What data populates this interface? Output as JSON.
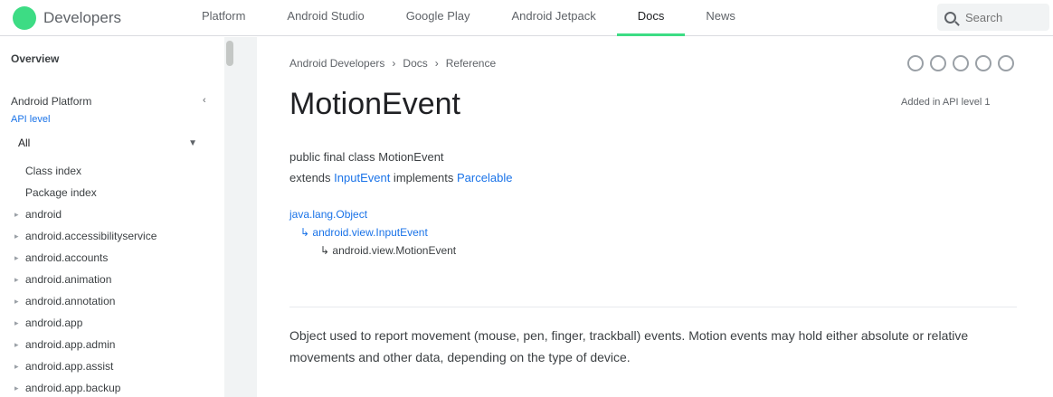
{
  "brand": {
    "name": "Developers",
    "accent": "#3ddc84"
  },
  "nav": {
    "tabs": [
      {
        "label": "Platform"
      },
      {
        "label": "Android Studio"
      },
      {
        "label": "Google Play"
      },
      {
        "label": "Android Jetpack"
      },
      {
        "label": "Docs"
      },
      {
        "label": "News"
      }
    ],
    "active_index": 4,
    "search_placeholder": "Search"
  },
  "sidebar": {
    "title": "Overview",
    "package_title": "Android Platform",
    "api_level": "API level",
    "filter_value": "All",
    "items": [
      {
        "label": "Class index",
        "expandable": false
      },
      {
        "label": "Package index",
        "expandable": false
      },
      {
        "label": "android",
        "expandable": true
      },
      {
        "label": "android.accessibilityservice",
        "expandable": true
      },
      {
        "label": "android.accounts",
        "expandable": true
      },
      {
        "label": "android.animation",
        "expandable": true
      },
      {
        "label": "android.annotation",
        "expandable": true
      },
      {
        "label": "android.app",
        "expandable": true
      },
      {
        "label": "android.app.admin",
        "expandable": true
      },
      {
        "label": "android.app.assist",
        "expandable": true
      },
      {
        "label": "android.app.backup",
        "expandable": true
      }
    ]
  },
  "main": {
    "breadcrumb": [
      "Android Developers",
      "Docs",
      "Reference"
    ],
    "title": "MotionEvent",
    "added_in": "Added in API level 1",
    "signature_line1": "public final class MotionEvent",
    "signature_extends_prefix": "extends ",
    "signature_extends": "InputEvent",
    "signature_implements_prefix": " implements ",
    "signature_implements": "Parcelable",
    "hierarchy": {
      "root": "java.lang.Object",
      "level1": "android.view.InputEvent",
      "level2": "android.view.MotionEvent"
    },
    "description": "Object used to report movement (mouse, pen, finger, trackball) events. Motion events may hold either absolute or relative movements and other data, depending on the type of device."
  }
}
